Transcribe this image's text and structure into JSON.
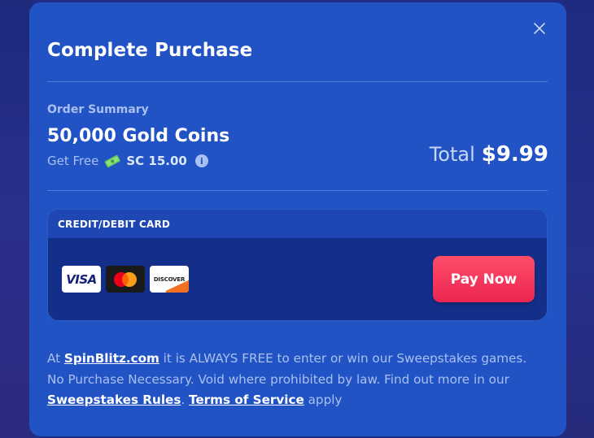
{
  "modal": {
    "title": "Complete Purchase",
    "close_icon": "close-icon"
  },
  "order": {
    "summary_label": "Order Summary",
    "product": "50,000 Gold Coins",
    "bonus_prefix": "Get Free",
    "bonus_icon": "cash-icon",
    "bonus_value": "SC 15.00",
    "info_icon": "info-icon",
    "total_label": "Total",
    "total_price": "$9.99"
  },
  "payment": {
    "method_label": "CREDIT/DEBIT CARD",
    "cards": [
      {
        "name": "visa",
        "label": "VISA"
      },
      {
        "name": "mastercard",
        "label": ""
      },
      {
        "name": "discover",
        "label": "DISCOVER"
      }
    ],
    "pay_button": "Pay Now"
  },
  "footer": {
    "part1": "At ",
    "site_link": "SpinBlitz.com",
    "part2": " it is ALWAYS FREE to enter or win our Sweepstakes games. No Purchase Necessary. Void where prohibited by law. Find out more in our ",
    "rules_link": "Sweepstakes Rules",
    "part3": ". ",
    "terms_link": "Terms of Service",
    "part4": " apply"
  },
  "colors": {
    "modal_bg": "#2253c4",
    "accent_button": "#ea2550",
    "muted_text": "#a9c0f0"
  }
}
